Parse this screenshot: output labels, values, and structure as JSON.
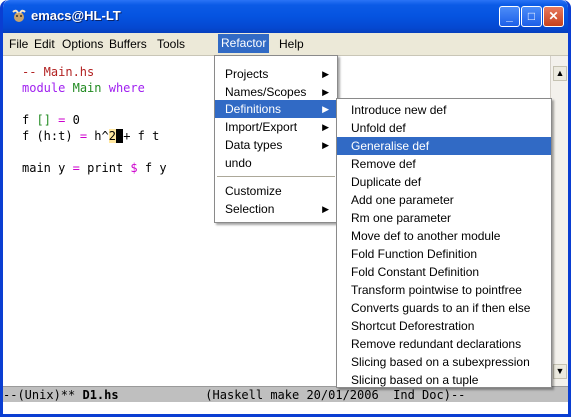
{
  "window": {
    "title": "emacs@HL-LT",
    "app_icon": "gnu-icon",
    "controls": [
      "minimize-icon",
      "maximize-icon",
      "close-icon"
    ]
  },
  "menubar": [
    "File",
    "Edit",
    "Options",
    "Buffers",
    "Tools",
    "Refactor",
    "Help"
  ],
  "editor": {
    "line1": "-- Main.hs",
    "line2_kw": "module",
    "line2_name": "Main",
    "line2_where": "where",
    "line3_a": "f",
    "line3_b": "[]",
    "line3_c": "=",
    "line3_d": "0",
    "line4_a": "f (h:t)",
    "line4_b": "=",
    "line4_c": "h^",
    "line4_d": "2",
    "line4_e": "+ f t",
    "line5_a": "main y",
    "line5_b": "=",
    "line5_c": "print",
    "line5_d": "$",
    "line5_e": "f y"
  },
  "refactor_menu": {
    "items": [
      "Projects",
      "Names/Scopes",
      "Definitions",
      "Import/Export",
      "Data types",
      "undo",
      "Customize",
      "Selection"
    ],
    "submenu_arrow": "▶"
  },
  "definitions_menu": {
    "items": [
      "Introduce new def",
      "Unfold def",
      "Generalise def",
      "Remove def",
      "Duplicate def",
      "Add one parameter",
      "Rm one parameter",
      "Move def to another module",
      "Fold Function Definition",
      "Fold Constant Definition",
      "Transform pointwise to pointfree",
      "Converts guards to an if then else",
      "Shortcut Deforestration",
      "Remove redundant declarations",
      "Slicing based on a subexpression",
      "Slicing based on a tuple"
    ],
    "highlighted": "Generalise def"
  },
  "modeline": {
    "left": "--(Unix)** ",
    "buffer": "D1.hs",
    "right": "            (Haskell make 20/01/2006  Ind Doc)--"
  },
  "scroll_up": "▲",
  "scroll_down": "▼",
  "colors": {
    "title_bar": "#0553e0",
    "menu_highlight": "#316ac5",
    "comment": "#b22222",
    "keyword": "#a020f0",
    "type": "#228b22",
    "operator": "#cd00cd"
  }
}
